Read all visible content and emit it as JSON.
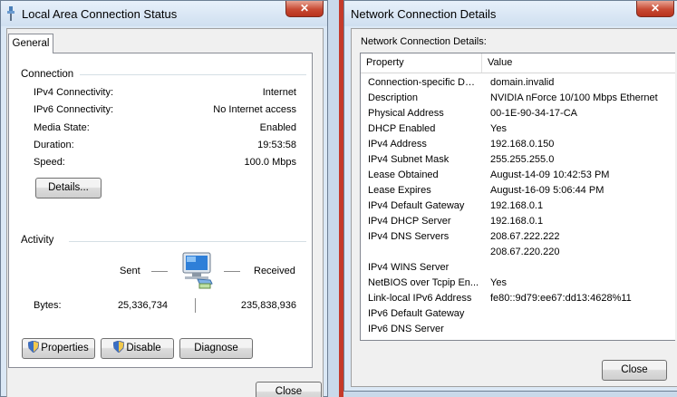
{
  "status_window": {
    "title": "Local Area Connection Status",
    "close_glyph": "✕",
    "tab": "General",
    "connection": {
      "heading": "Connection",
      "rows": [
        {
          "label": "IPv4 Connectivity:",
          "value": "Internet"
        },
        {
          "label": "IPv6 Connectivity:",
          "value": "No Internet access"
        },
        {
          "label": "Media State:",
          "value": "Enabled"
        },
        {
          "label": "Duration:",
          "value": "19:53:58"
        },
        {
          "label": "Speed:",
          "value": "100.0 Mbps"
        }
      ],
      "details_button": "Details..."
    },
    "activity": {
      "heading": "Activity",
      "sent_label": "Sent",
      "received_label": "Received",
      "bytes_label": "Bytes:",
      "bytes_sent": "25,336,734",
      "bytes_received": "235,838,936"
    },
    "buttons": {
      "properties": "Properties",
      "disable": "Disable",
      "diagnose": "Diagnose",
      "close": "Close"
    }
  },
  "details_window": {
    "title": "Network Connection Details",
    "close_glyph": "✕",
    "list_caption": "Network Connection Details:",
    "columns": {
      "property": "Property",
      "value": "Value"
    },
    "rows": [
      {
        "property": "Connection-specific DN...",
        "value": "domain.invalid"
      },
      {
        "property": "Description",
        "value": "NVIDIA nForce 10/100 Mbps Ethernet"
      },
      {
        "property": "Physical Address",
        "value": "00-1E-90-34-17-CA"
      },
      {
        "property": "DHCP Enabled",
        "value": "Yes"
      },
      {
        "property": "IPv4 Address",
        "value": "192.168.0.150"
      },
      {
        "property": "IPv4 Subnet Mask",
        "value": "255.255.255.0"
      },
      {
        "property": "Lease Obtained",
        "value": "August-14-09 10:42:53 PM"
      },
      {
        "property": "Lease Expires",
        "value": "August-16-09 5:06:44 PM"
      },
      {
        "property": "IPv4 Default Gateway",
        "value": "192.168.0.1"
      },
      {
        "property": "IPv4 DHCP Server",
        "value": "192.168.0.1"
      },
      {
        "property": "IPv4 DNS Servers",
        "value": "208.67.222.222"
      },
      {
        "property": "",
        "value": "208.67.220.220"
      },
      {
        "property": "IPv4 WINS Server",
        "value": ""
      },
      {
        "property": "NetBIOS over Tcpip En...",
        "value": "Yes"
      },
      {
        "property": "Link-local IPv6 Address",
        "value": "fe80::9d79:ee67:dd13:4628%11"
      },
      {
        "property": "IPv6 Default Gateway",
        "value": ""
      },
      {
        "property": "IPv6 DNS Server",
        "value": ""
      }
    ],
    "close_button": "Close"
  },
  "colors": {
    "title_bar": "#dbe8f5",
    "close_red": "#c74a33",
    "background_red": "#c53a2a"
  }
}
